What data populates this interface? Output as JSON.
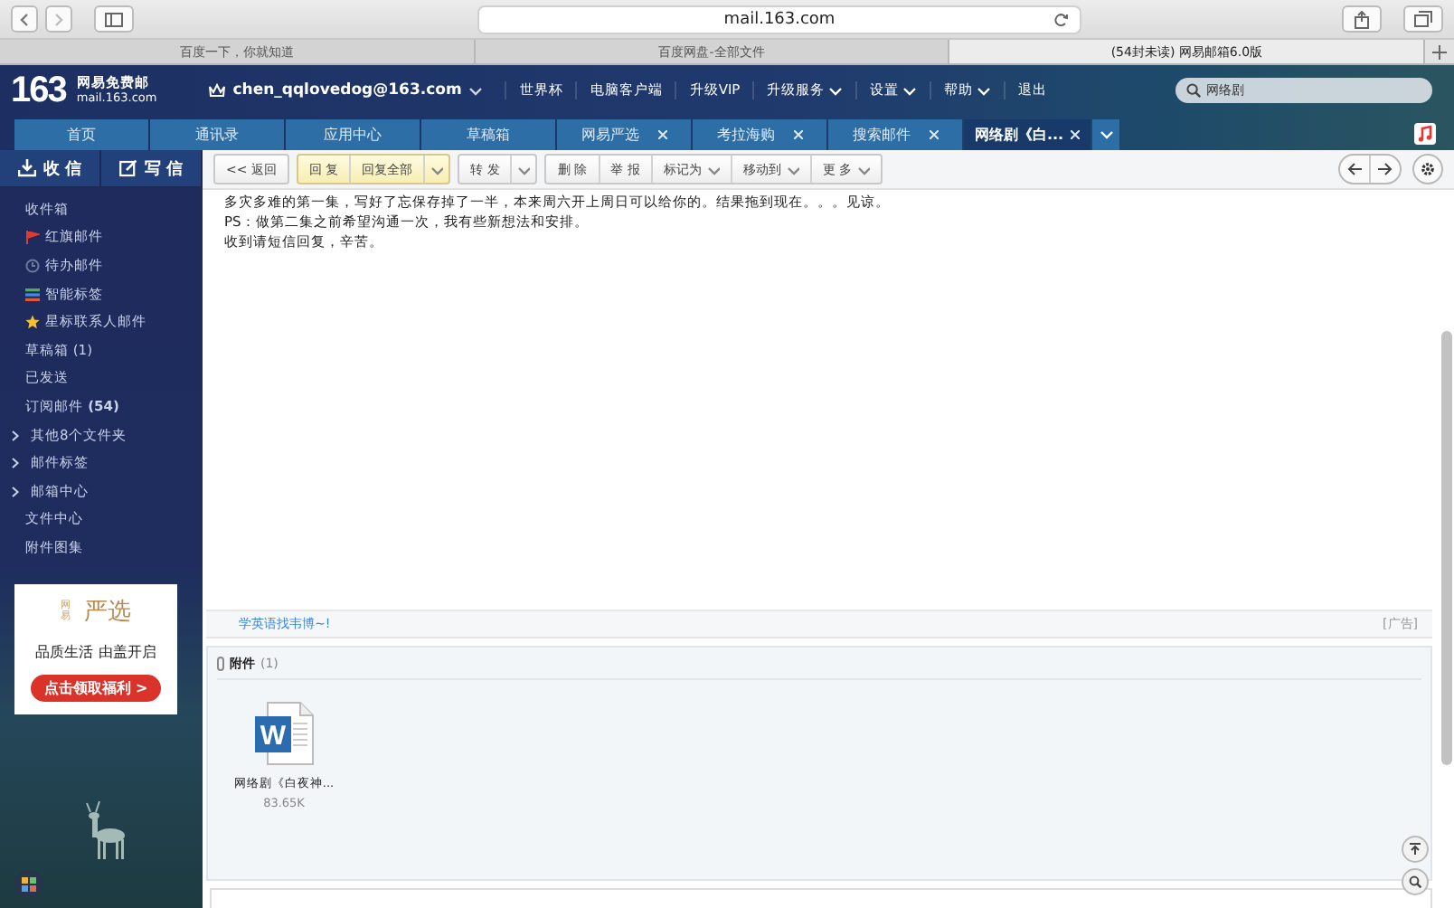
{
  "browser": {
    "url": "mail.163.com",
    "tabs": [
      {
        "label": "百度一下，你就知道",
        "selected": false
      },
      {
        "label": "百度网盘-全部文件",
        "selected": false
      },
      {
        "label": "(54封未读) 网易邮箱6.0版",
        "selected": true
      }
    ]
  },
  "header": {
    "logo_number": "163",
    "logo_title": "网易免费邮",
    "logo_domain": "mail.163.com",
    "account": "chen_qqlovedog@163.com",
    "links": [
      {
        "label": "世界杯",
        "dropdown": false
      },
      {
        "label": "电脑客户端",
        "dropdown": false
      },
      {
        "label": "升级VIP",
        "dropdown": false
      },
      {
        "label": "升级服务",
        "dropdown": true
      },
      {
        "label": "设置",
        "dropdown": true
      },
      {
        "label": "帮助",
        "dropdown": true
      },
      {
        "label": "退出",
        "dropdown": false
      }
    ],
    "search": {
      "value": "网络剧"
    }
  },
  "nav_tabs": [
    {
      "label": "首页",
      "selected": false,
      "closable": false
    },
    {
      "label": "通讯录",
      "selected": false,
      "closable": false
    },
    {
      "label": "应用中心",
      "selected": false,
      "closable": false
    },
    {
      "label": "草稿箱",
      "selected": false,
      "closable": false
    },
    {
      "label": "网易严选",
      "selected": false,
      "closable": true
    },
    {
      "label": "考拉海购",
      "selected": false,
      "closable": true
    },
    {
      "label": "搜索邮件",
      "selected": false,
      "closable": true
    },
    {
      "label": "网络剧《白...",
      "selected": true,
      "closable": true
    }
  ],
  "sidebar": {
    "buttons": [
      {
        "label": "收 信",
        "kind": "receive"
      },
      {
        "label": "写 信",
        "kind": "compose"
      }
    ],
    "folders": [
      {
        "label": "收件箱",
        "kind": "plain"
      },
      {
        "label": "红旗邮件",
        "kind": "flag"
      },
      {
        "label": "待办邮件",
        "kind": "clock"
      },
      {
        "label": "智能标签",
        "kind": "tags"
      },
      {
        "label": "星标联系人邮件",
        "kind": "star"
      },
      {
        "label": "草稿箱",
        "kind": "plain",
        "count": "(1)",
        "bold_count": false
      },
      {
        "label": "已发送",
        "kind": "plain"
      },
      {
        "label": "订阅邮件",
        "kind": "plain",
        "count": "(54)",
        "bold_count": true
      },
      {
        "label": "其他8个文件夹",
        "kind": "group"
      },
      {
        "label": "邮件标签",
        "kind": "group"
      },
      {
        "label": "邮箱中心",
        "kind": "group"
      },
      {
        "label": "文件中心",
        "kind": "plain"
      },
      {
        "label": "附件图集",
        "kind": "plain"
      }
    ],
    "ad": {
      "brand_small": "网易",
      "brand": "严选",
      "slogan": "品质生活 由盖开启",
      "button": "点击领取福利 >"
    }
  },
  "toolbar": {
    "groups": [
      {
        "highlight": false,
        "items": [
          {
            "label": "<< 返回",
            "kind": "button"
          }
        ]
      },
      {
        "highlight": true,
        "items": [
          {
            "label": "回 复",
            "kind": "button"
          },
          {
            "label": "回复全部",
            "kind": "button"
          },
          {
            "kind": "caret"
          }
        ]
      },
      {
        "highlight": false,
        "items": [
          {
            "label": "转 发",
            "kind": "button"
          },
          {
            "kind": "caret"
          }
        ]
      },
      {
        "highlight": false,
        "items": [
          {
            "label": "删 除",
            "kind": "button"
          },
          {
            "label": "举 报",
            "kind": "button"
          },
          {
            "label": "标记为",
            "kind": "menu"
          },
          {
            "label": "移动到",
            "kind": "menu"
          },
          {
            "label": "更 多",
            "kind": "menu"
          }
        ]
      }
    ]
  },
  "message": {
    "lines": [
      "多灾多难的第一集，写好了忘保存掉了一半，本来周六开上周日可以给你的。结果拖到现在。。。见谅。",
      "PS：做第二集之前希望沟通一次，我有些新想法和安排。",
      "收到请短信回复，辛苦。"
    ]
  },
  "ad_bar": {
    "link": "学英语找韦博~!",
    "tag": "[广告]"
  },
  "attachments": {
    "title": "附件",
    "count": "(1)",
    "files": [
      {
        "name": "网络剧《白夜神...",
        "size": "83.65K",
        "kind": "word",
        "icon_letter": "W"
      }
    ]
  }
}
